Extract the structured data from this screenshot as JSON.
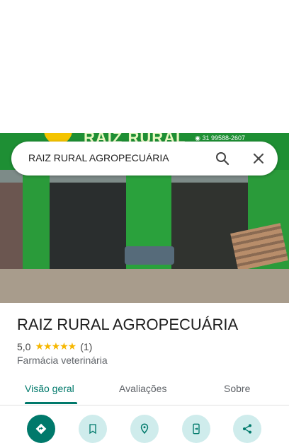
{
  "search": {
    "query": "RAIZ RURAL AGROPECUÁRIA"
  },
  "photo_sign": {
    "name": "RAIZ RURAL",
    "phone": "31 99588-2607"
  },
  "place": {
    "title": "RAIZ RURAL AGROPECUÁRIA",
    "rating": "5,0",
    "stars": "★★★★★",
    "reviews": "(1)",
    "category": "Farmácia veterinária"
  },
  "tabs": [
    "Visão geral",
    "Avaliações",
    "Sobre"
  ],
  "actions": [
    "directions-icon",
    "save-icon",
    "nearby-icon",
    "send-to-phone-icon",
    "share-icon"
  ],
  "colors": {
    "accent": "#00796b",
    "star": "#f6b700"
  }
}
